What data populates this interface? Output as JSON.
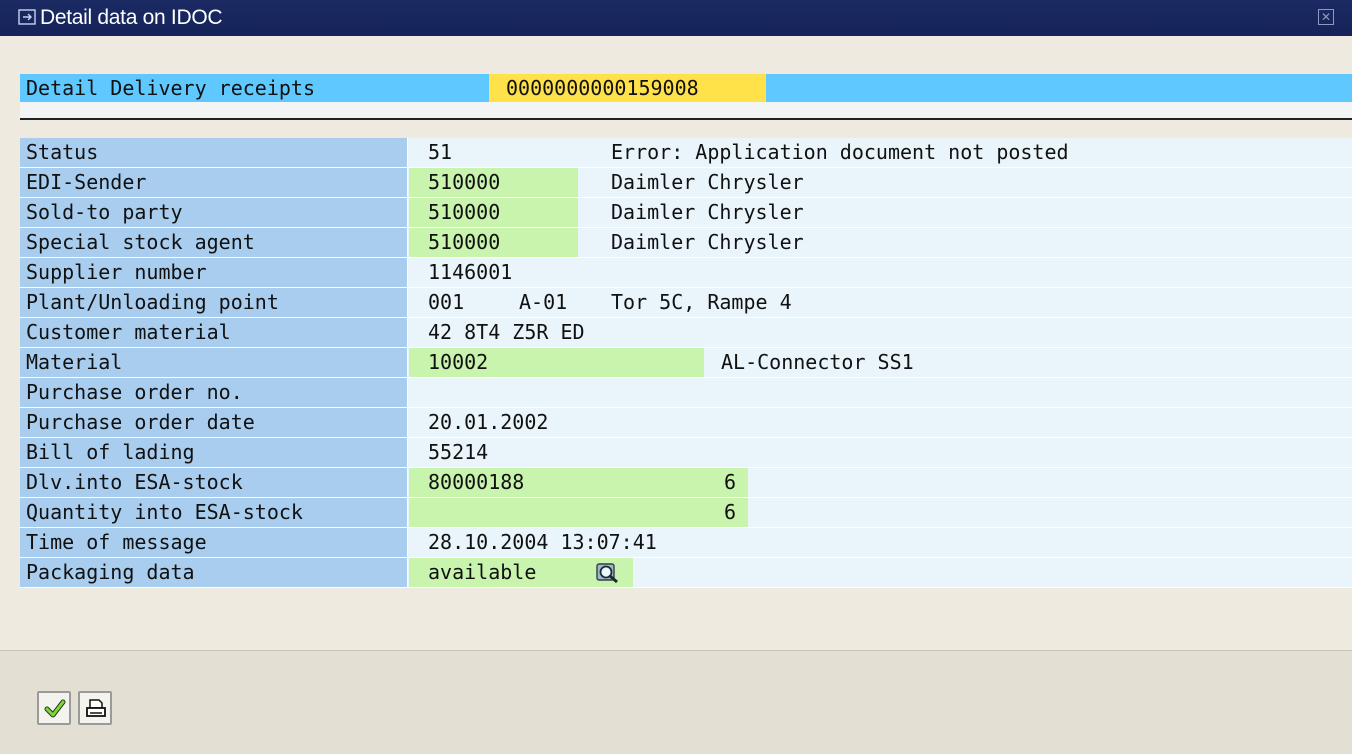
{
  "window": {
    "title": "Detail data on IDOC",
    "title_icon": "dialog-icon",
    "close_icon": "close-icon"
  },
  "header": {
    "label": "Detail Delivery receipts",
    "value": "0000000000159008"
  },
  "rows": [
    {
      "label": "Status",
      "value": "51",
      "text": "Error: Application document not posted"
    },
    {
      "label": "EDI-Sender",
      "value": "510000",
      "text": "Daimler Chrysler"
    },
    {
      "label": "Sold-to party",
      "value": "510000",
      "text": "Daimler Chrysler"
    },
    {
      "label": "Special stock agent",
      "value": "510000",
      "text": "Daimler Chrysler"
    },
    {
      "label": "Supplier number",
      "value": "1146001"
    },
    {
      "label": "Plant/Unloading point",
      "value": "001",
      "value2": "A-01",
      "text": "Tor 5C, Rampe 4"
    },
    {
      "label": "Customer material",
      "value": "42 8T4 Z5R ED"
    },
    {
      "label": "Material",
      "value": "10002",
      "text": "AL-Connector SS1"
    },
    {
      "label": "Purchase order no.",
      "value": ""
    },
    {
      "label": "Purchase order date",
      "value": "20.01.2002"
    },
    {
      "label": "Bill of lading",
      "value": "55214"
    },
    {
      "label": "Dlv.into ESA-stock",
      "value": "80000188",
      "qty": "6"
    },
    {
      "label": "Quantity into ESA-stock",
      "value": "",
      "qty": "6"
    },
    {
      "label": "Time of message",
      "value": "28.10.2004 13:07:41"
    },
    {
      "label": "Packaging data",
      "value": "available",
      "icon": "magnifier-icon"
    }
  ],
  "toolbar": {
    "ok_icon": "checkmark-icon",
    "print_icon": "printer-icon"
  },
  "colors": {
    "title_bar": "#15235a",
    "header_row": "#5fc8ff",
    "header_value": "#ffe14a",
    "label_cell": "#a8cdee",
    "editable_cell": "#c9f4ad",
    "row_background": "#eaf5fb"
  }
}
